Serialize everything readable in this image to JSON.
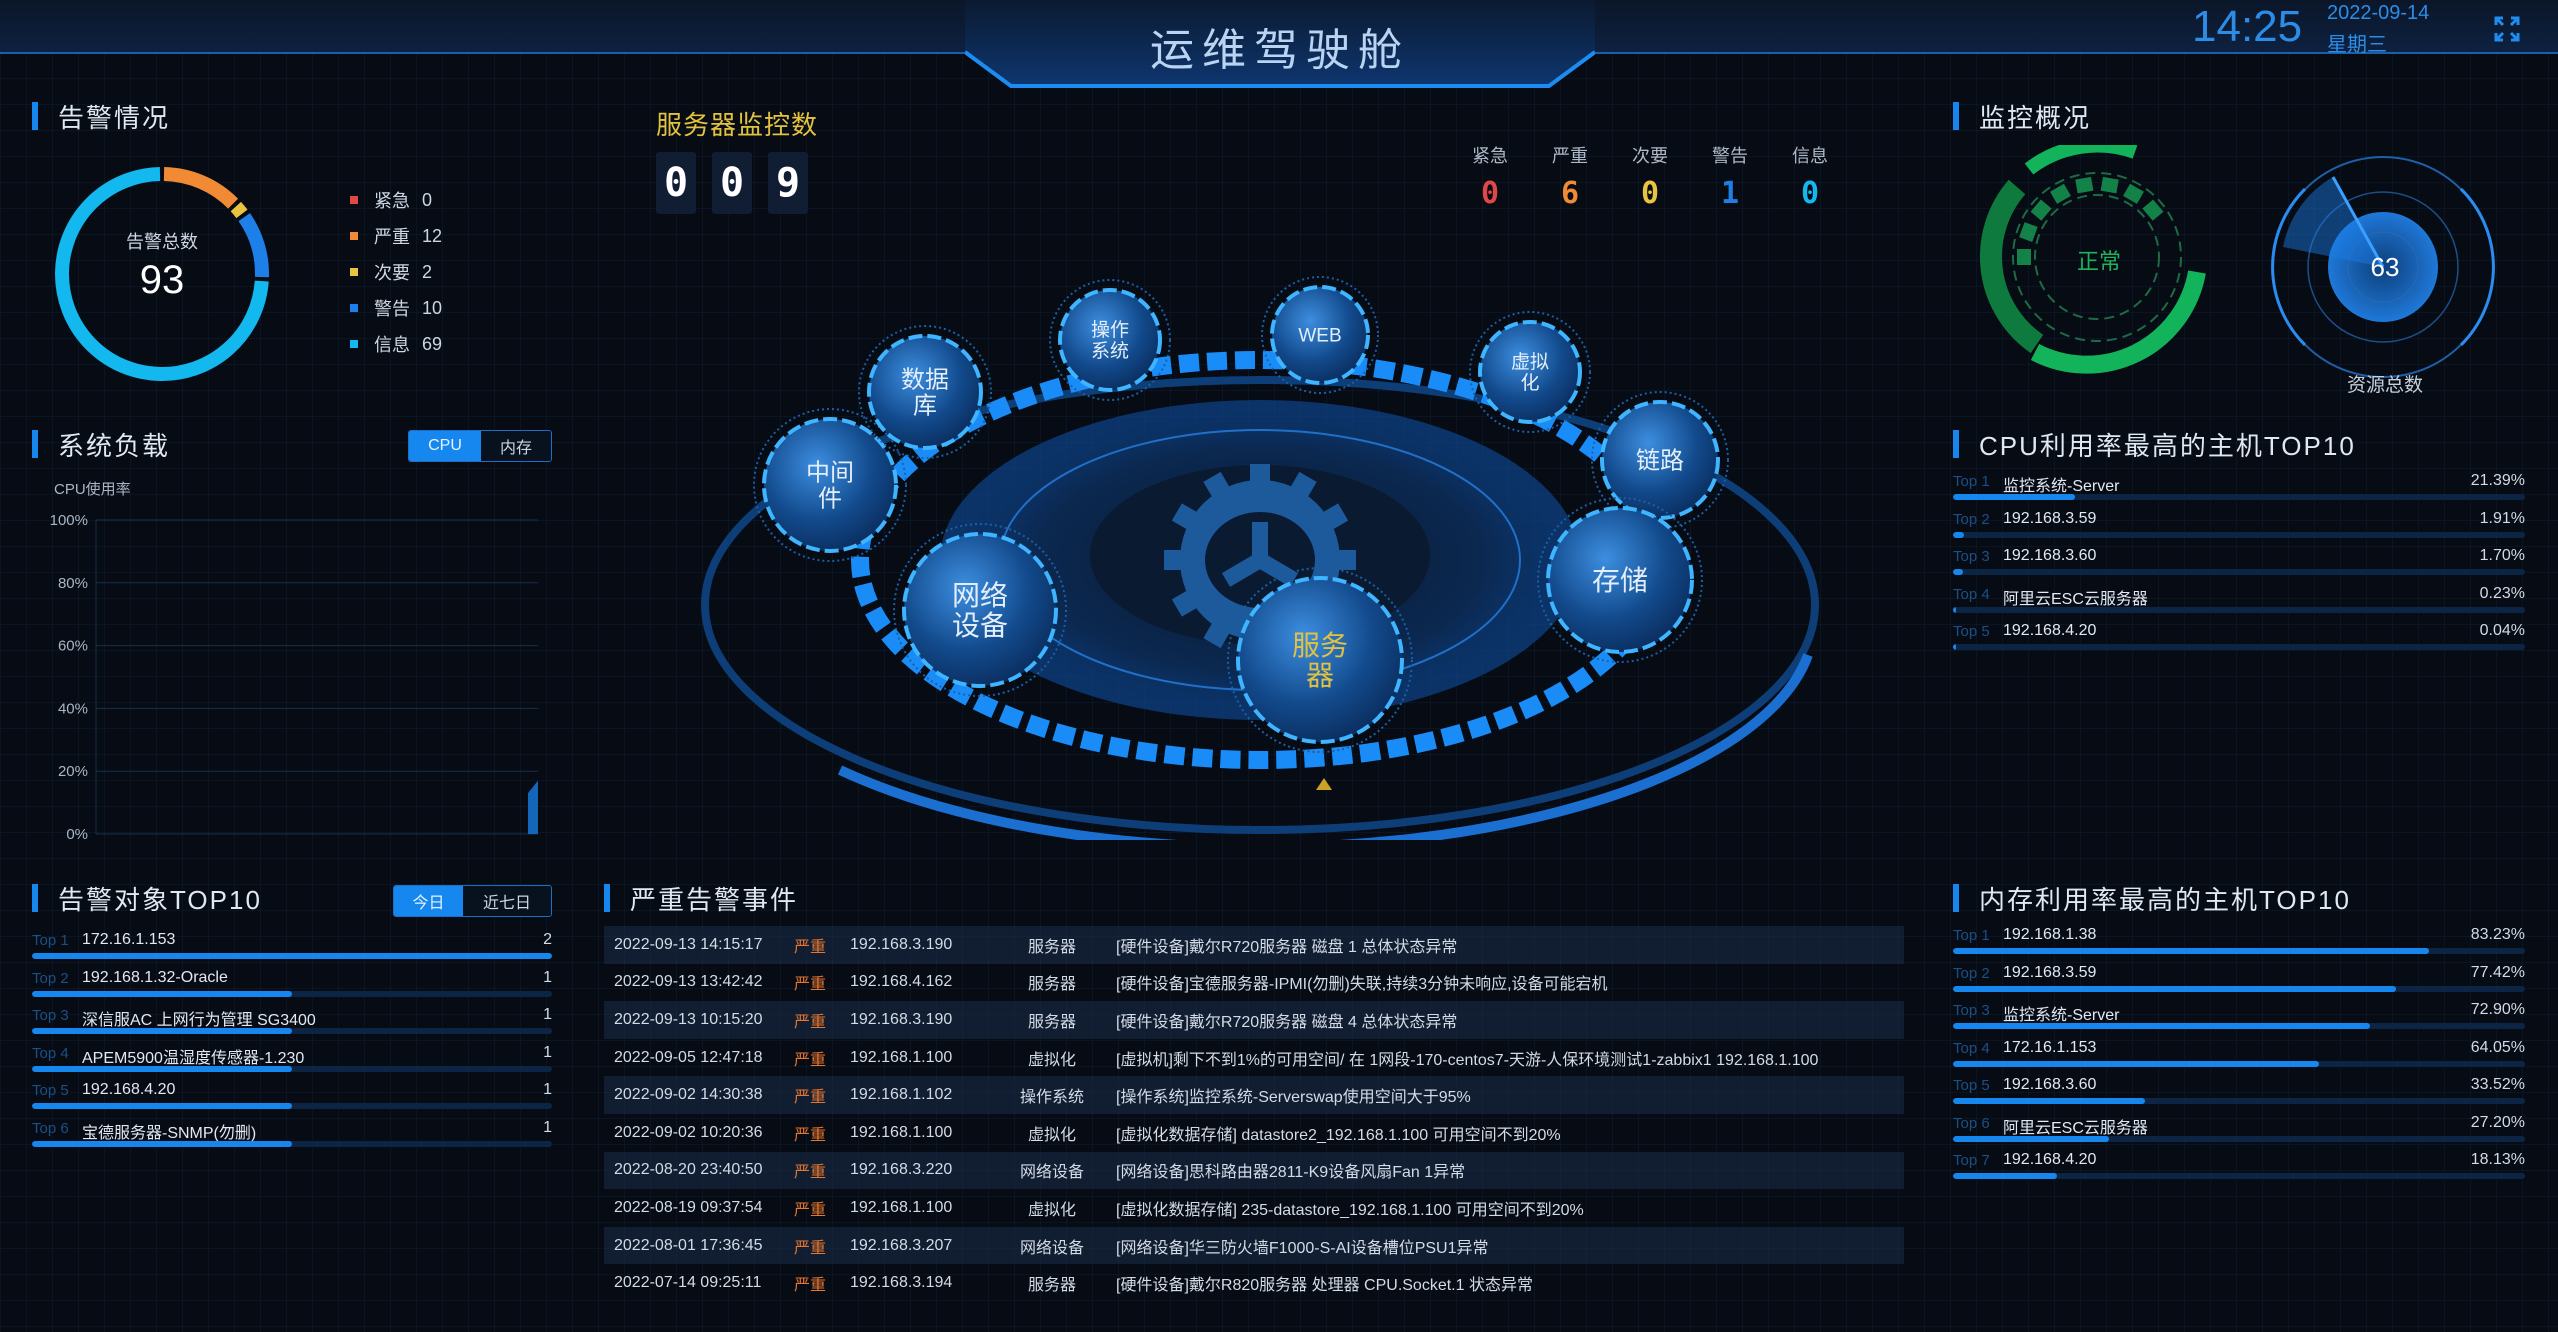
{
  "header": {
    "title": "运维驾驶舱",
    "time": "14:25",
    "date": "2022-09-14",
    "weekday": "星期三",
    "fullscreen_icon": "fullscreen-expand-icon"
  },
  "alarm_overview": {
    "title": "告警情况",
    "center_label": "告警总数",
    "total": "93",
    "legend": [
      {
        "label": "紧急",
        "value": "0",
        "color": "#e04848"
      },
      {
        "label": "严重",
        "value": "12",
        "color": "#f08a34"
      },
      {
        "label": "次要",
        "value": "2",
        "color": "#e8c440"
      },
      {
        "label": "警告",
        "value": "10",
        "color": "#1f7fe8"
      },
      {
        "label": "信息",
        "value": "69",
        "color": "#13b8ee"
      }
    ]
  },
  "system_load": {
    "title": "系统负载",
    "tabs": [
      {
        "label": "CPU",
        "active": true
      },
      {
        "label": "内存",
        "active": false
      }
    ],
    "chart_ylabel": "CPU使用率"
  },
  "chart_data": {
    "type": "area",
    "title": "",
    "ylabel": "CPU使用率",
    "xlabel": "",
    "ylim": [
      0,
      100
    ],
    "yticks": [
      "0%",
      "20%",
      "40%",
      "60%",
      "80%",
      "100%"
    ],
    "grid": true,
    "series": [
      {
        "name": "CPU使用率",
        "values": [
          0,
          13,
          17
        ]
      }
    ],
    "note": "Only a small rising area at far right edge is drawn (~13% to ~17%)"
  },
  "alarm_targets": {
    "title": "告警对象TOP10",
    "tabs": [
      {
        "label": "今日",
        "active": true
      },
      {
        "label": "近七日",
        "active": false
      }
    ],
    "items": [
      {
        "rank": "Top 1",
        "name": "172.16.1.153",
        "value": "2",
        "fraction": 1.0
      },
      {
        "rank": "Top 2",
        "name": "192.168.1.32-Oracle",
        "value": "1",
        "fraction": 0.5
      },
      {
        "rank": "Top 3",
        "name": "深信服AC 上网行为管理 SG3400",
        "value": "1",
        "fraction": 0.5
      },
      {
        "rank": "Top 4",
        "name": "APEM5900温湿度传感器-1.230",
        "value": "1",
        "fraction": 0.5
      },
      {
        "rank": "Top 5",
        "name": "192.168.4.20",
        "value": "1",
        "fraction": 0.5
      },
      {
        "rank": "Top 6",
        "name": "宝德服务器-SNMP(勿删)",
        "value": "1",
        "fraction": 0.5
      }
    ]
  },
  "server_monitor": {
    "title": "服务器监控数",
    "digits": [
      "0",
      "0",
      "9"
    ],
    "severity": [
      {
        "label": "紧急",
        "value": "0",
        "color": "#e04848"
      },
      {
        "label": "严重",
        "value": "6",
        "color": "#f08a34"
      },
      {
        "label": "次要",
        "value": "0",
        "color": "#e8c440"
      },
      {
        "label": "警告",
        "value": "1",
        "color": "#1f7fe8"
      },
      {
        "label": "信息",
        "value": "0",
        "color": "#13b8ee"
      }
    ]
  },
  "center_diagram": {
    "nodes": [
      {
        "label": "操作\n系统",
        "highlight": false
      },
      {
        "label": "WEB",
        "highlight": false
      },
      {
        "label": "虚拟\n化",
        "highlight": false
      },
      {
        "label": "链路",
        "highlight": false
      },
      {
        "label": "存储",
        "highlight": false
      },
      {
        "label": "服务\n器",
        "highlight": true
      },
      {
        "label": "网络\n设备",
        "highlight": false
      },
      {
        "label": "中间\n件",
        "highlight": false
      },
      {
        "label": "数据\n库",
        "highlight": false
      }
    ],
    "center_icon": "gear-icon"
  },
  "monitor_overview": {
    "title": "监控概况",
    "status_label": "正常",
    "resource_total": "63",
    "resource_label": "资源总数"
  },
  "cpu_top": {
    "title": "CPU利用率最高的主机TOP10",
    "items": [
      {
        "rank": "Top 1",
        "name": "监控系统-Server",
        "value": "21.39%",
        "fraction": 0.2139
      },
      {
        "rank": "Top 2",
        "name": "192.168.3.59",
        "value": "1.91%",
        "fraction": 0.0191
      },
      {
        "rank": "Top 3",
        "name": "192.168.3.60",
        "value": "1.70%",
        "fraction": 0.017
      },
      {
        "rank": "Top 4",
        "name": "阿里云ESC云服务器",
        "value": "0.23%",
        "fraction": 0.0023
      },
      {
        "rank": "Top 5",
        "name": "192.168.4.20",
        "value": "0.04%",
        "fraction": 0.0004
      }
    ]
  },
  "mem_top": {
    "title": "内存利用率最高的主机TOP10",
    "items": [
      {
        "rank": "Top 1",
        "name": "192.168.1.38",
        "value": "83.23%",
        "fraction": 0.8323
      },
      {
        "rank": "Top 2",
        "name": "192.168.3.59",
        "value": "77.42%",
        "fraction": 0.7742
      },
      {
        "rank": "Top 3",
        "name": "监控系统-Server",
        "value": "72.90%",
        "fraction": 0.729
      },
      {
        "rank": "Top 4",
        "name": "172.16.1.153",
        "value": "64.05%",
        "fraction": 0.6405
      },
      {
        "rank": "Top 5",
        "name": "192.168.3.60",
        "value": "33.52%",
        "fraction": 0.3352
      },
      {
        "rank": "Top 6",
        "name": "阿里云ESC云服务器",
        "value": "27.20%",
        "fraction": 0.272
      },
      {
        "rank": "Top 7",
        "name": "192.168.4.20",
        "value": "18.13%",
        "fraction": 0.1813
      }
    ]
  },
  "critical_events": {
    "title": "严重告警事件",
    "rows": [
      {
        "time": "2022-09-13 14:15:17",
        "severity": "严重",
        "ip": "192.168.3.190",
        "type": "服务器",
        "desc": "[硬件设备]戴尔R720服务器 磁盘 1 总体状态异常"
      },
      {
        "time": "2022-09-13 13:42:42",
        "severity": "严重",
        "ip": "192.168.4.162",
        "type": "服务器",
        "desc": "[硬件设备]宝德服务器-IPMI(勿删)失联,持续3分钟未响应,设备可能宕机"
      },
      {
        "time": "2022-09-13 10:15:20",
        "severity": "严重",
        "ip": "192.168.3.190",
        "type": "服务器",
        "desc": "[硬件设备]戴尔R720服务器 磁盘 4 总体状态异常"
      },
      {
        "time": "2022-09-05 12:47:18",
        "severity": "严重",
        "ip": "192.168.1.100",
        "type": "虚拟化",
        "desc": "[虚拟机]剩下不到1%的可用空间/ 在 1网段-170-centos7-天游-人保环境测试1-zabbix1 192.168.1.100"
      },
      {
        "time": "2022-09-02 14:30:38",
        "severity": "严重",
        "ip": "192.168.1.102",
        "type": "操作系统",
        "desc": "[操作系统]监控系统-Serverswap使用空间大于95%"
      },
      {
        "time": "2022-09-02 10:20:36",
        "severity": "严重",
        "ip": "192.168.1.100",
        "type": "虚拟化",
        "desc": "[虚拟化数据存储] datastore2_192.168.1.100 可用空间不到20%"
      },
      {
        "time": "2022-08-20 23:40:50",
        "severity": "严重",
        "ip": "192.168.3.220",
        "type": "网络设备",
        "desc": "[网络设备]思科路由器2811-K9设备风扇Fan 1异常"
      },
      {
        "time": "2022-08-19 09:37:54",
        "severity": "严重",
        "ip": "192.168.1.100",
        "type": "虚拟化",
        "desc": "[虚拟化数据存储] 235-datastore_192.168.1.100 可用空间不到20%"
      },
      {
        "time": "2022-08-01 17:36:45",
        "severity": "严重",
        "ip": "192.168.3.207",
        "type": "网络设备",
        "desc": "[网络设备]华三防火墙F1000-S-AI设备槽位PSU1异常"
      },
      {
        "time": "2022-07-14 09:25:11",
        "severity": "严重",
        "ip": "192.168.3.194",
        "type": "服务器",
        "desc": "[硬件设备]戴尔R820服务器 处理器 CPU.Socket.1 状态异常"
      }
    ]
  }
}
